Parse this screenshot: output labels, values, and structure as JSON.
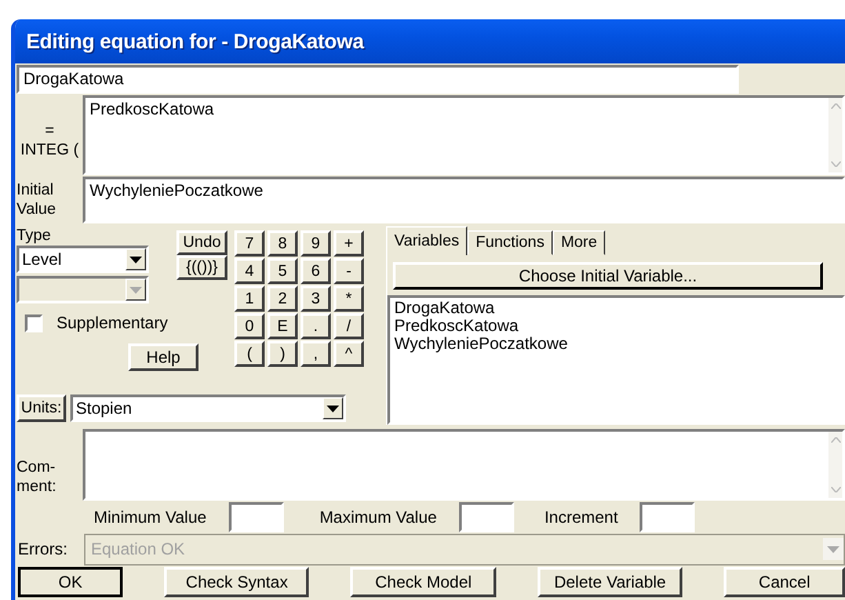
{
  "window": {
    "title": "Editing equation for - DrogaKatowa"
  },
  "variable_name": "DrogaKatowa",
  "equation": {
    "label_lines": [
      "=",
      "INTEG ("
    ],
    "value": "PredkoscKatowa"
  },
  "initial_value": {
    "label_lines": [
      "Initial",
      "Value"
    ],
    "value": "WychyleniePoczatkowe"
  },
  "type": {
    "label": "Type",
    "value": "Level",
    "subtype_disabled": true
  },
  "supplementary": {
    "label": "Supplementary",
    "checked": false
  },
  "undo": "Undo",
  "brackets": "{(())}",
  "keypad": [
    "7",
    "8",
    "9",
    "+",
    "4",
    "5",
    "6",
    "-",
    "1",
    "2",
    "3",
    "*",
    "0",
    "E",
    ".",
    "/",
    "(",
    ")",
    ",",
    "^"
  ],
  "help": "Help",
  "units": {
    "label": "Units:",
    "value": "Stopien"
  },
  "tabs": [
    {
      "label": "Variables",
      "selected": true
    },
    {
      "label": "Functions",
      "selected": false
    },
    {
      "label": "More",
      "selected": false
    }
  ],
  "choose_button": "Choose Initial Variable...",
  "variables": [
    "DrogaKatowa",
    "PredkoscKatowa",
    "WychyleniePoczatkowe"
  ],
  "comment": {
    "label_lines": [
      "Com-",
      "ment:"
    ]
  },
  "limits": [
    "Minimum Value",
    "Maximum Value",
    "Increment"
  ],
  "errors": {
    "label": "Errors:",
    "value": "Equation OK",
    "disabled": true
  },
  "buttons": [
    {
      "label": "OK",
      "default": true
    },
    {
      "label": "Check Syntax",
      "default": false
    },
    {
      "label": "Check Model",
      "default": false
    },
    {
      "label": "Delete Variable",
      "default": false
    },
    {
      "label": "Cancel",
      "default": false
    }
  ]
}
